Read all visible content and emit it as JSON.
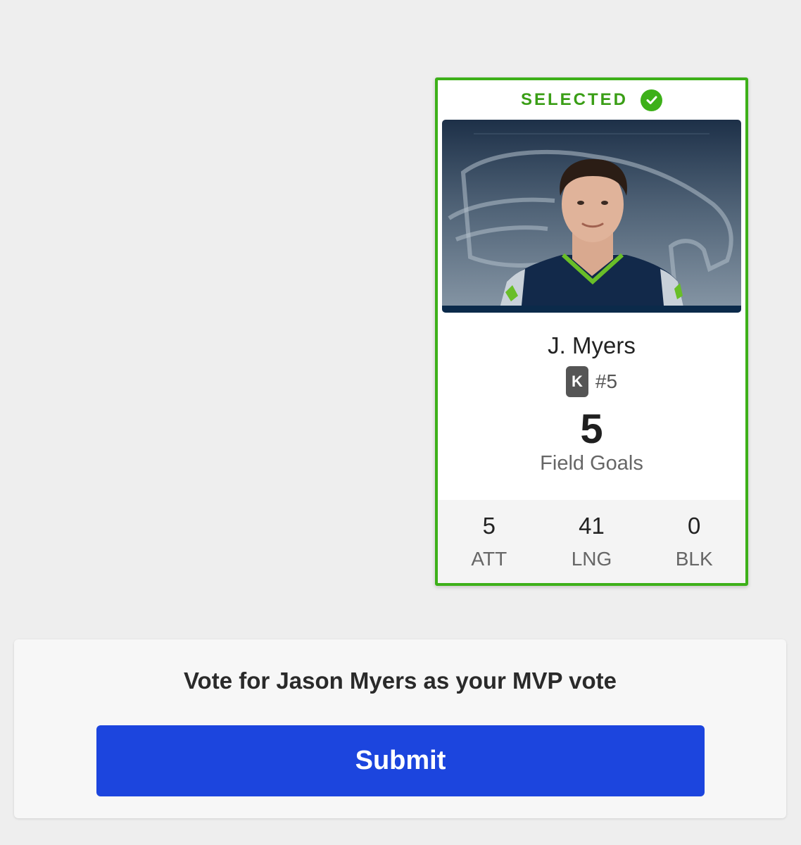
{
  "card": {
    "selected_label": "SELECTED",
    "player_name": "J. Myers",
    "position": "K",
    "jersey": "#5",
    "main_stat_value": "5",
    "main_stat_label": "Field Goals",
    "stats": [
      {
        "value": "5",
        "label": "ATT"
      },
      {
        "value": "41",
        "label": "LNG"
      },
      {
        "value": "0",
        "label": "BLK"
      }
    ],
    "photo_alt": "Player headshot with team logo background"
  },
  "vote": {
    "prompt": "Vote for Jason Myers as your MVP vote",
    "submit_label": "Submit"
  },
  "colors": {
    "selected_green": "#3db019",
    "submit_blue": "#1c45de",
    "team_navy": "#0b2a4a",
    "team_green": "#69be28"
  }
}
